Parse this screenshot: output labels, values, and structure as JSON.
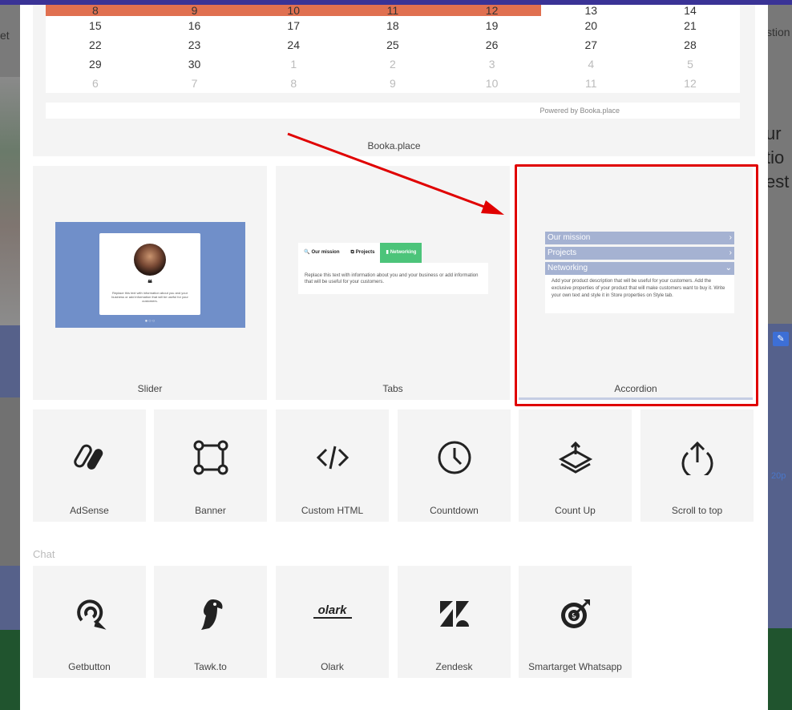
{
  "background": {
    "left_nav_text": "et",
    "right_nav_text": "stion",
    "right_texts": [
      "ur",
      "tio",
      "est"
    ],
    "right_px_label": "20p"
  },
  "calendar": {
    "rows": [
      [
        {
          "v": "8",
          "s": "hl"
        },
        {
          "v": "9",
          "s": "hl"
        },
        {
          "v": "10",
          "s": "hl"
        },
        {
          "v": "11",
          "s": "hl"
        },
        {
          "v": "12",
          "s": "hl"
        },
        {
          "v": "13",
          "s": ""
        },
        {
          "v": "14",
          "s": ""
        }
      ],
      [
        {
          "v": "15",
          "s": ""
        },
        {
          "v": "16",
          "s": ""
        },
        {
          "v": "17",
          "s": ""
        },
        {
          "v": "18",
          "s": ""
        },
        {
          "v": "19",
          "s": ""
        },
        {
          "v": "20",
          "s": ""
        },
        {
          "v": "21",
          "s": ""
        }
      ],
      [
        {
          "v": "22",
          "s": ""
        },
        {
          "v": "23",
          "s": ""
        },
        {
          "v": "24",
          "s": ""
        },
        {
          "v": "25",
          "s": ""
        },
        {
          "v": "26",
          "s": ""
        },
        {
          "v": "27",
          "s": ""
        },
        {
          "v": "28",
          "s": ""
        }
      ],
      [
        {
          "v": "29",
          "s": ""
        },
        {
          "v": "30",
          "s": ""
        },
        {
          "v": "1",
          "s": "muted"
        },
        {
          "v": "2",
          "s": "muted"
        },
        {
          "v": "3",
          "s": "muted"
        },
        {
          "v": "4",
          "s": "muted"
        },
        {
          "v": "5",
          "s": "muted"
        }
      ],
      [
        {
          "v": "6",
          "s": "muted"
        },
        {
          "v": "7",
          "s": "muted"
        },
        {
          "v": "8",
          "s": "muted"
        },
        {
          "v": "9",
          "s": "muted"
        },
        {
          "v": "10",
          "s": "muted"
        },
        {
          "v": "11",
          "s": "muted"
        },
        {
          "v": "12",
          "s": "muted"
        }
      ]
    ],
    "powered_by": "Powered by Booka.place",
    "label": "Booka.place"
  },
  "slider": {
    "label": "Slider",
    "quote_mark": "❝",
    "text": "Replace this text with information about you and your business or add information that will be useful for your customers.",
    "dots": "●○○"
  },
  "tabs": {
    "label": "Tabs",
    "items": [
      {
        "icon": "🔍",
        "label": "Our mission",
        "active": false
      },
      {
        "icon": "⧉",
        "label": "Projects",
        "active": false
      },
      {
        "icon": "▮",
        "label": "Networking",
        "active": true
      }
    ],
    "body": "Replace this text with information about you and your business or add information that will be useful for your customers."
  },
  "accordion": {
    "label": "Accordion",
    "items": [
      {
        "label": "Our mission",
        "chevron": "›"
      },
      {
        "label": "Projects",
        "chevron": "›"
      },
      {
        "label": "Networking",
        "chevron": "⌄"
      }
    ],
    "body": "Add your product description that will be useful for your customers. Add the exclusive properties of your product that will make customers want to buy it. Write your own text and style it in Store properties on Style tab."
  },
  "widgets": [
    {
      "name": "adsense",
      "label": "AdSense",
      "icon": "adsense-icon"
    },
    {
      "name": "banner",
      "label": "Banner",
      "icon": "banner-icon"
    },
    {
      "name": "custom-html",
      "label": "Custom HTML",
      "icon": "code-icon"
    },
    {
      "name": "countdown",
      "label": "Countdown",
      "icon": "clock-icon"
    },
    {
      "name": "count-up",
      "label": "Count Up",
      "icon": "stack-up-icon"
    },
    {
      "name": "scroll-to-top",
      "label": "Scroll to top",
      "icon": "arrow-up-circle-icon"
    }
  ],
  "chat_section": {
    "title": "Chat",
    "items": [
      {
        "name": "getbutton",
        "label": "Getbutton",
        "icon": "getbutton-icon"
      },
      {
        "name": "tawk",
        "label": "Tawk.to",
        "icon": "parrot-icon"
      },
      {
        "name": "olark",
        "label": "Olark",
        "icon": "olark-icon",
        "logo_text": "olark"
      },
      {
        "name": "zendesk",
        "label": "Zendesk",
        "icon": "zendesk-icon"
      },
      {
        "name": "smartarget",
        "label": "Smartarget Whatsapp",
        "icon": "target-icon"
      }
    ]
  },
  "colors": {
    "calendar_highlight": "#e07050",
    "slider_bg": "#708fc9",
    "tab_active": "#4cc47a",
    "accordion_row": "#a5b2d2",
    "annotation_red": "#e00000"
  }
}
